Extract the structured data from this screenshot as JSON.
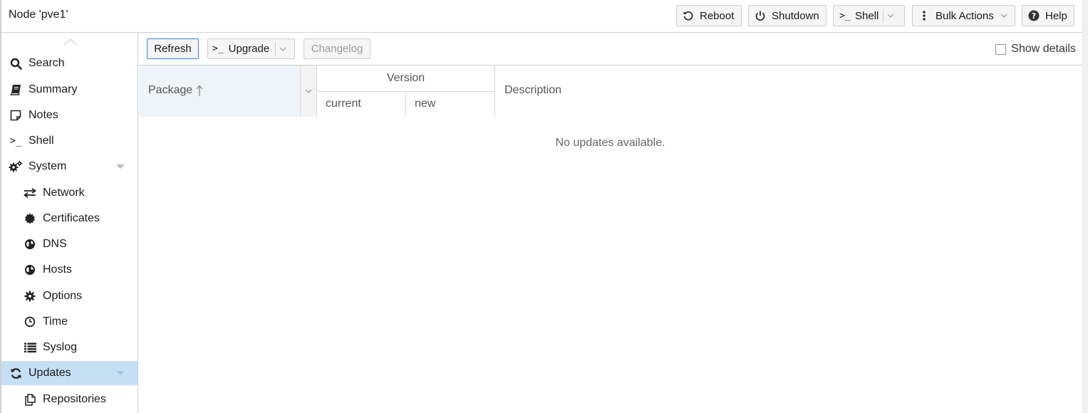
{
  "header": {
    "title": "Node 'pve1'",
    "buttons": {
      "reboot": "Reboot",
      "shutdown": "Shutdown",
      "shell": "Shell",
      "bulk": "Bulk Actions",
      "help": "Help"
    }
  },
  "sidebar": {
    "items": [
      {
        "label": "Search",
        "icon": "search-icon"
      },
      {
        "label": "Summary",
        "icon": "book-icon"
      },
      {
        "label": "Notes",
        "icon": "sticky-note-icon"
      },
      {
        "label": "Shell",
        "icon": "terminal-icon"
      },
      {
        "label": "System",
        "icon": "cogs-icon"
      },
      {
        "label": "Network",
        "icon": "exchange-icon"
      },
      {
        "label": "Certificates",
        "icon": "certificate-icon"
      },
      {
        "label": "DNS",
        "icon": "globe-icon"
      },
      {
        "label": "Hosts",
        "icon": "globe-icon"
      },
      {
        "label": "Options",
        "icon": "gear-icon"
      },
      {
        "label": "Time",
        "icon": "clock-icon"
      },
      {
        "label": "Syslog",
        "icon": "list-icon"
      },
      {
        "label": "Updates",
        "icon": "refresh-icon"
      },
      {
        "label": "Repositories",
        "icon": "files-icon"
      }
    ],
    "active": "Updates"
  },
  "toolbar": {
    "refresh": "Refresh",
    "upgrade": "Upgrade",
    "changelog": "Changelog",
    "show_details": "Show details"
  },
  "grid": {
    "columns": {
      "package": "Package",
      "version": "Version",
      "current": "current",
      "new": "new",
      "description": "Description"
    },
    "empty_text": "No updates available."
  },
  "colors": {
    "active_nav": "#c5dff5",
    "focus_border": "#3c8ad5",
    "sorted_header": "#eef4fa"
  }
}
